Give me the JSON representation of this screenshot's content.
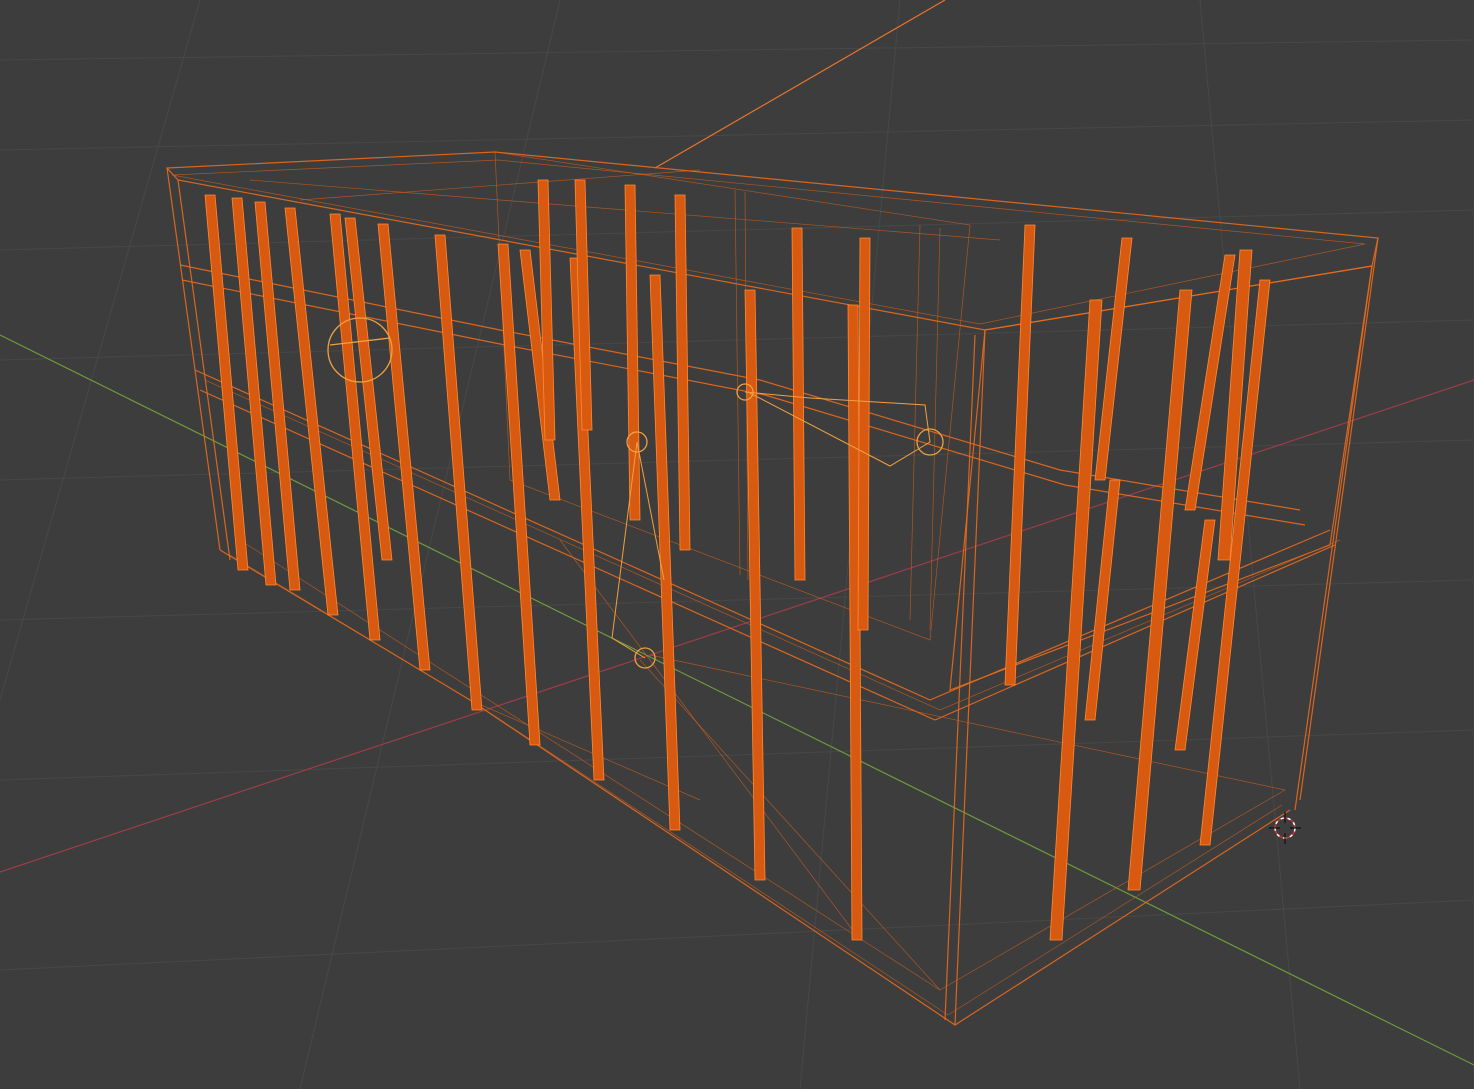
{
  "app": {
    "view": "3D Viewport",
    "shading": "wireframe"
  },
  "colors": {
    "background": "#3d3d3d",
    "grid": "#484848",
    "axis_x": "#9c3c4a",
    "axis_y": "#6c9a3c",
    "selection": "#e86a1c",
    "active": "#f0a040"
  },
  "icons": {
    "cursor": "3d-cursor-icon",
    "lights": "light-icon",
    "empty": "empty-icon"
  }
}
